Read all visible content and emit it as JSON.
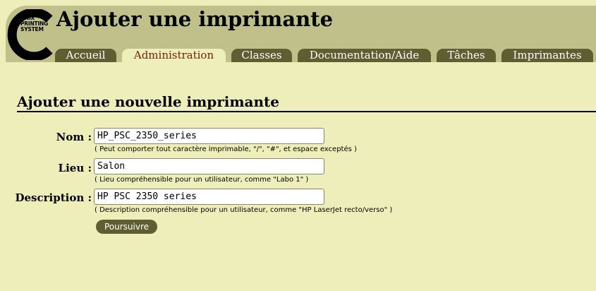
{
  "logo": {
    "lines": [
      "UNIX",
      "PRINTING",
      "SYSTEM"
    ]
  },
  "page_title": "Ajouter une imprimante",
  "tabs": [
    {
      "label": "Accueil",
      "active": false
    },
    {
      "label": "Administration",
      "active": true
    },
    {
      "label": "Classes",
      "active": false
    },
    {
      "label": "Documentation/Aide",
      "active": false
    },
    {
      "label": "Tâches",
      "active": false
    },
    {
      "label": "Imprimantes",
      "active": false
    }
  ],
  "section_title": "Ajouter une nouvelle imprimante",
  "form": {
    "name": {
      "label": "Nom :",
      "value": "HP_PSC_2350_series",
      "hint": "( Peut comporter tout caractère imprimable, \"/\", \"#\", et espace exceptés )"
    },
    "location": {
      "label": "Lieu :",
      "value": "Salon",
      "hint": "( Lieu compréhensible pour un utilisateur, comme \"Labo 1\" )"
    },
    "description": {
      "label": "Description :",
      "value": "HP PSC 2350 series",
      "hint": "( Description compréhensible pour un utilisateur, comme \"HP LaserJet recto/verso\" )"
    },
    "submit_label": "Poursuivre"
  },
  "colors": {
    "background": "#eeeeba",
    "header": "#c0c08a",
    "tab": "#5e5e32",
    "active_tab_text": "#7a1e00"
  }
}
